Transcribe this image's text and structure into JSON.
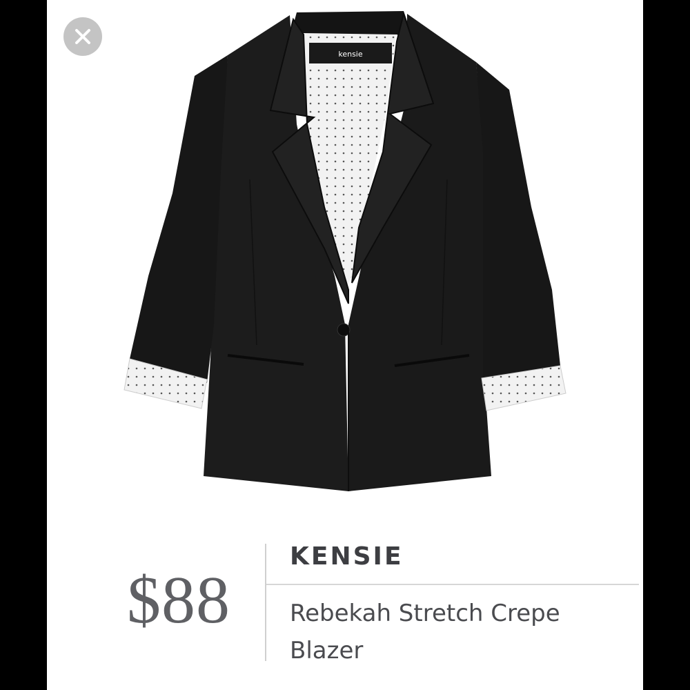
{
  "close_button": {
    "icon": "close-icon",
    "label": "×"
  },
  "product": {
    "image_icon": "blazer-photo",
    "label_text": "kensie",
    "brand": "KENSIE",
    "name": "Rebekah Stretch Crepe Blazer",
    "price": "$88"
  },
  "colors": {
    "page_background": "#000000",
    "card_background": "#ffffff",
    "text_primary": "#3d3e42",
    "price_text": "#5f6064",
    "divider": "#cfcfcf",
    "close_button_bg": "#c4c4c4"
  }
}
